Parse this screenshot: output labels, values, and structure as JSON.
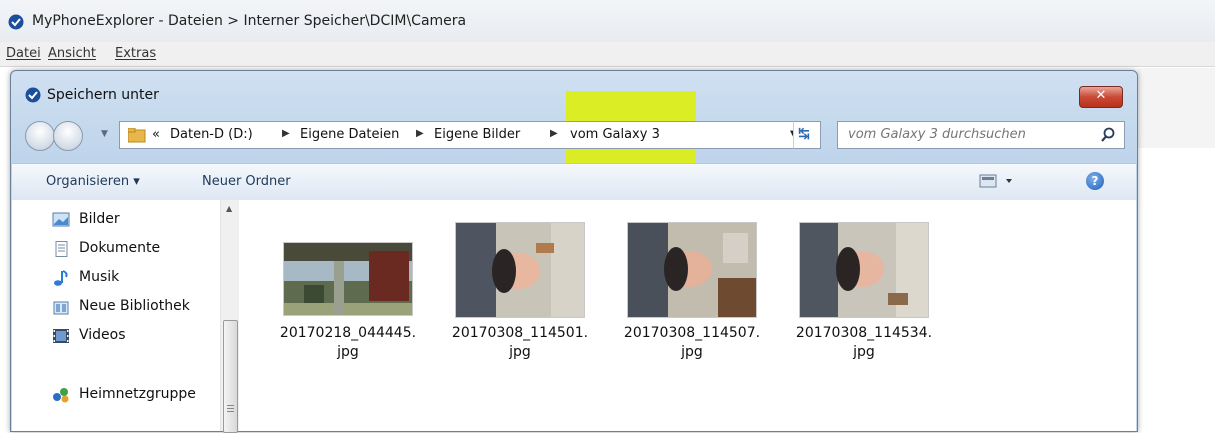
{
  "app": {
    "title": "MyPhoneExplorer -  Dateien > Interner Speicher\\DCIM\\Camera",
    "menu": [
      "Datei",
      "Ansicht",
      "Extras"
    ]
  },
  "dialog": {
    "title": "Speichern unter",
    "close_label": "✕",
    "breadcrumb": {
      "overflow": "«",
      "items": [
        "Daten-D (D:)",
        "Eigene Dateien",
        "Eigene Bilder",
        "vom Galaxy 3"
      ],
      "highlight_color": "#dff000"
    },
    "search": {
      "placeholder": "vom Galaxy 3 durchsuchen"
    },
    "toolbar": {
      "organize_label": "Organisieren ▾",
      "new_folder_label": "Neuer Ordner",
      "help_label": "?"
    },
    "nav_pane": {
      "items": [
        {
          "label": "Bilder",
          "icon": "pictures-icon"
        },
        {
          "label": "Dokumente",
          "icon": "documents-icon"
        },
        {
          "label": "Musik",
          "icon": "music-icon"
        },
        {
          "label": "Neue Bibliothek",
          "icon": "library-icon"
        },
        {
          "label": "Videos",
          "icon": "videos-icon"
        },
        {
          "label": "Heimnetzgruppe",
          "icon": "homegroup-icon"
        }
      ]
    },
    "files": [
      {
        "name_line1": "20170218_044445.",
        "name_line2": "jpg"
      },
      {
        "name_line1": "20170308_114501.",
        "name_line2": "jpg"
      },
      {
        "name_line1": "20170308_114507.",
        "name_line2": "jpg"
      },
      {
        "name_line1": "20170308_114534.",
        "name_line2": "jpg"
      }
    ]
  }
}
